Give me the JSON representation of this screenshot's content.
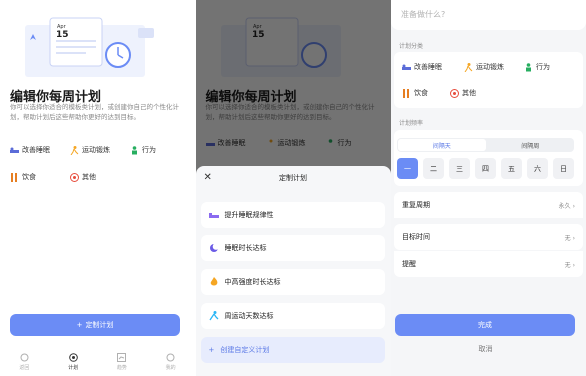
{
  "screen1": {
    "illustration": {
      "month": "Apr",
      "day": "15"
    },
    "title": "编辑你每周计划",
    "description": "你可以选择你适合的模板类计划，或创建你自己的个性化计划，帮助计划后这些帮助你更好的达到目标。",
    "categories": [
      {
        "label": "改善睡眠",
        "icon": "sleep-icon"
      },
      {
        "label": "运动锻炼",
        "icon": "run-icon"
      },
      {
        "label": "行为",
        "icon": "person-icon"
      },
      {
        "label": "饮食",
        "icon": "food-icon"
      },
      {
        "label": "其他",
        "icon": "target-icon"
      }
    ],
    "primary_button": "定制计划",
    "tabs": [
      {
        "label": "返回",
        "icon": "back-icon"
      },
      {
        "label": "计划",
        "icon": "plan-icon"
      },
      {
        "label": "趋势",
        "icon": "chart-icon"
      },
      {
        "label": "我的",
        "icon": "profile-icon"
      }
    ]
  },
  "screen2": {
    "sheet_title": "定制计划",
    "plans": [
      {
        "label": "提升睡眠规律性",
        "icon": "bed-icon"
      },
      {
        "label": "睡眠时长达标",
        "icon": "moon-icon"
      },
      {
        "label": "中高强度时长达标",
        "icon": "fire-icon"
      },
      {
        "label": "周运动天数达标",
        "icon": "runner-icon"
      }
    ],
    "custom": "创建自定义计划"
  },
  "screen3": {
    "placeholder": "准备做什么?",
    "category_label": "计划分类",
    "frequency_label": "计划频率",
    "frequency_tabs": [
      "间隔天",
      "间隔周"
    ],
    "days": [
      "一",
      "二",
      "三",
      "四",
      "五",
      "六",
      "日"
    ],
    "rows": [
      {
        "label": "重复周期",
        "value": "永久"
      },
      {
        "label": "目标时间",
        "value": "无"
      },
      {
        "label": "提醒",
        "value": "无"
      }
    ],
    "done": "完成",
    "cancel": "取消"
  },
  "colors": {
    "accent": "#6b8cf5",
    "sleep": "#5b6cd8",
    "run": "#f5a623",
    "behavior": "#27ae60",
    "food": "#e67e22",
    "other": "#e74c3c"
  }
}
